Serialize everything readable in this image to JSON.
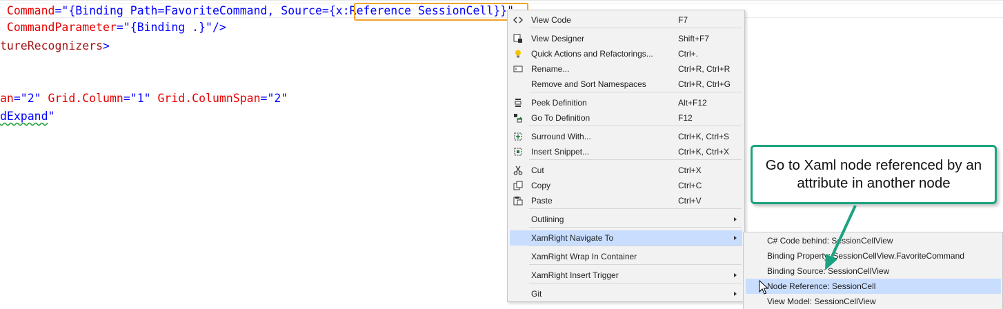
{
  "code": {
    "lines": [
      {
        "tokens": [
          {
            "text": " Command",
            "cls": "attr"
          },
          {
            "text": "=\"{Binding Path=FavoriteCommand, Source={",
            "cls": "val"
          },
          {
            "text": "x:Reference SessionCell}}\"",
            "cls": "val"
          }
        ]
      },
      {
        "tokens": [
          {
            "text": " CommandParameter",
            "cls": "attr"
          },
          {
            "text": "=\"{Binding .}\"",
            "cls": "val"
          },
          {
            "text": "/>",
            "cls": "punc"
          }
        ]
      },
      {
        "tokens": [
          {
            "text": "tureRecognizers",
            "cls": "elem"
          },
          {
            "text": ">",
            "cls": "punc"
          }
        ]
      },
      {
        "tokens": []
      },
      {
        "tokens": []
      },
      {
        "tokens": [
          {
            "text": "an",
            "cls": "attr"
          },
          {
            "text": "=\"2\" ",
            "cls": "val"
          },
          {
            "text": "Grid.Column",
            "cls": "attr"
          },
          {
            "text": "=\"1\" ",
            "cls": "val"
          },
          {
            "text": "Grid.ColumnSpan",
            "cls": "attr"
          },
          {
            "text": "=\"2\"",
            "cls": "val"
          }
        ]
      },
      {
        "tokens": [
          {
            "text": "dExpand",
            "cls": "val squig"
          },
          {
            "text": "\"",
            "cls": "val"
          }
        ]
      }
    ]
  },
  "context_menu": {
    "items": [
      {
        "label": "View Code",
        "shortcut": "F7",
        "icon": "view-code-icon"
      },
      {
        "label": "View Designer",
        "shortcut": "Shift+F7",
        "icon": "view-designer-icon"
      },
      {
        "label": "Quick Actions and Refactorings...",
        "shortcut": "Ctrl+.",
        "icon": "lightbulb-icon"
      },
      {
        "label": "Rename...",
        "shortcut": "Ctrl+R, Ctrl+R",
        "icon": "rename-icon"
      },
      {
        "label": "Remove and Sort Namespaces",
        "shortcut": "Ctrl+R, Ctrl+G",
        "icon": ""
      },
      {
        "label": "Peek Definition",
        "shortcut": "Alt+F12",
        "icon": "peek-definition-icon"
      },
      {
        "label": "Go To Definition",
        "shortcut": "F12",
        "icon": "go-to-definition-icon"
      },
      {
        "label": "Surround With...",
        "shortcut": "Ctrl+K, Ctrl+S",
        "icon": "surround-with-icon"
      },
      {
        "label": "Insert Snippet...",
        "shortcut": "Ctrl+K, Ctrl+X",
        "icon": "insert-snippet-icon"
      },
      {
        "label": "Cut",
        "shortcut": "Ctrl+X",
        "icon": "scissors-icon"
      },
      {
        "label": "Copy",
        "shortcut": "Ctrl+C",
        "icon": "copy-icon"
      },
      {
        "label": "Paste",
        "shortcut": "Ctrl+V",
        "icon": "paste-icon"
      },
      {
        "label": "Outlining",
        "shortcut": "",
        "icon": "",
        "submenu": true
      },
      {
        "label": "XamRight Navigate To",
        "shortcut": "",
        "icon": "",
        "submenu": true,
        "highlighted": true
      },
      {
        "label": "XamRight Wrap In Container",
        "shortcut": "",
        "icon": ""
      },
      {
        "label": "XamRight Insert Trigger",
        "shortcut": "",
        "icon": "",
        "submenu": true
      },
      {
        "label": "Git",
        "shortcut": "",
        "icon": "",
        "submenu": true
      }
    ]
  },
  "navigate_submenu": {
    "items": [
      {
        "label": "C# Code behind: SessionCellView"
      },
      {
        "label": "Binding Property: SessionCellView.FavoriteCommand"
      },
      {
        "label": "Binding Source: SessionCellView"
      },
      {
        "label": "Node Reference: SessionCell",
        "highlighted": true
      },
      {
        "label": "View Model: SessionCellView"
      }
    ]
  },
  "callout": {
    "text": "Go to Xaml node referenced by an attribute in another node",
    "border_color": "#1ba37f"
  },
  "colors": {
    "menu_background": "#f2f2f2",
    "menu_highlight": "#c9deff",
    "reference_highlight": "#f0a22a",
    "xml_attribute": "#e50000",
    "xml_value": "#0000ff",
    "xml_element": "#a31515"
  }
}
